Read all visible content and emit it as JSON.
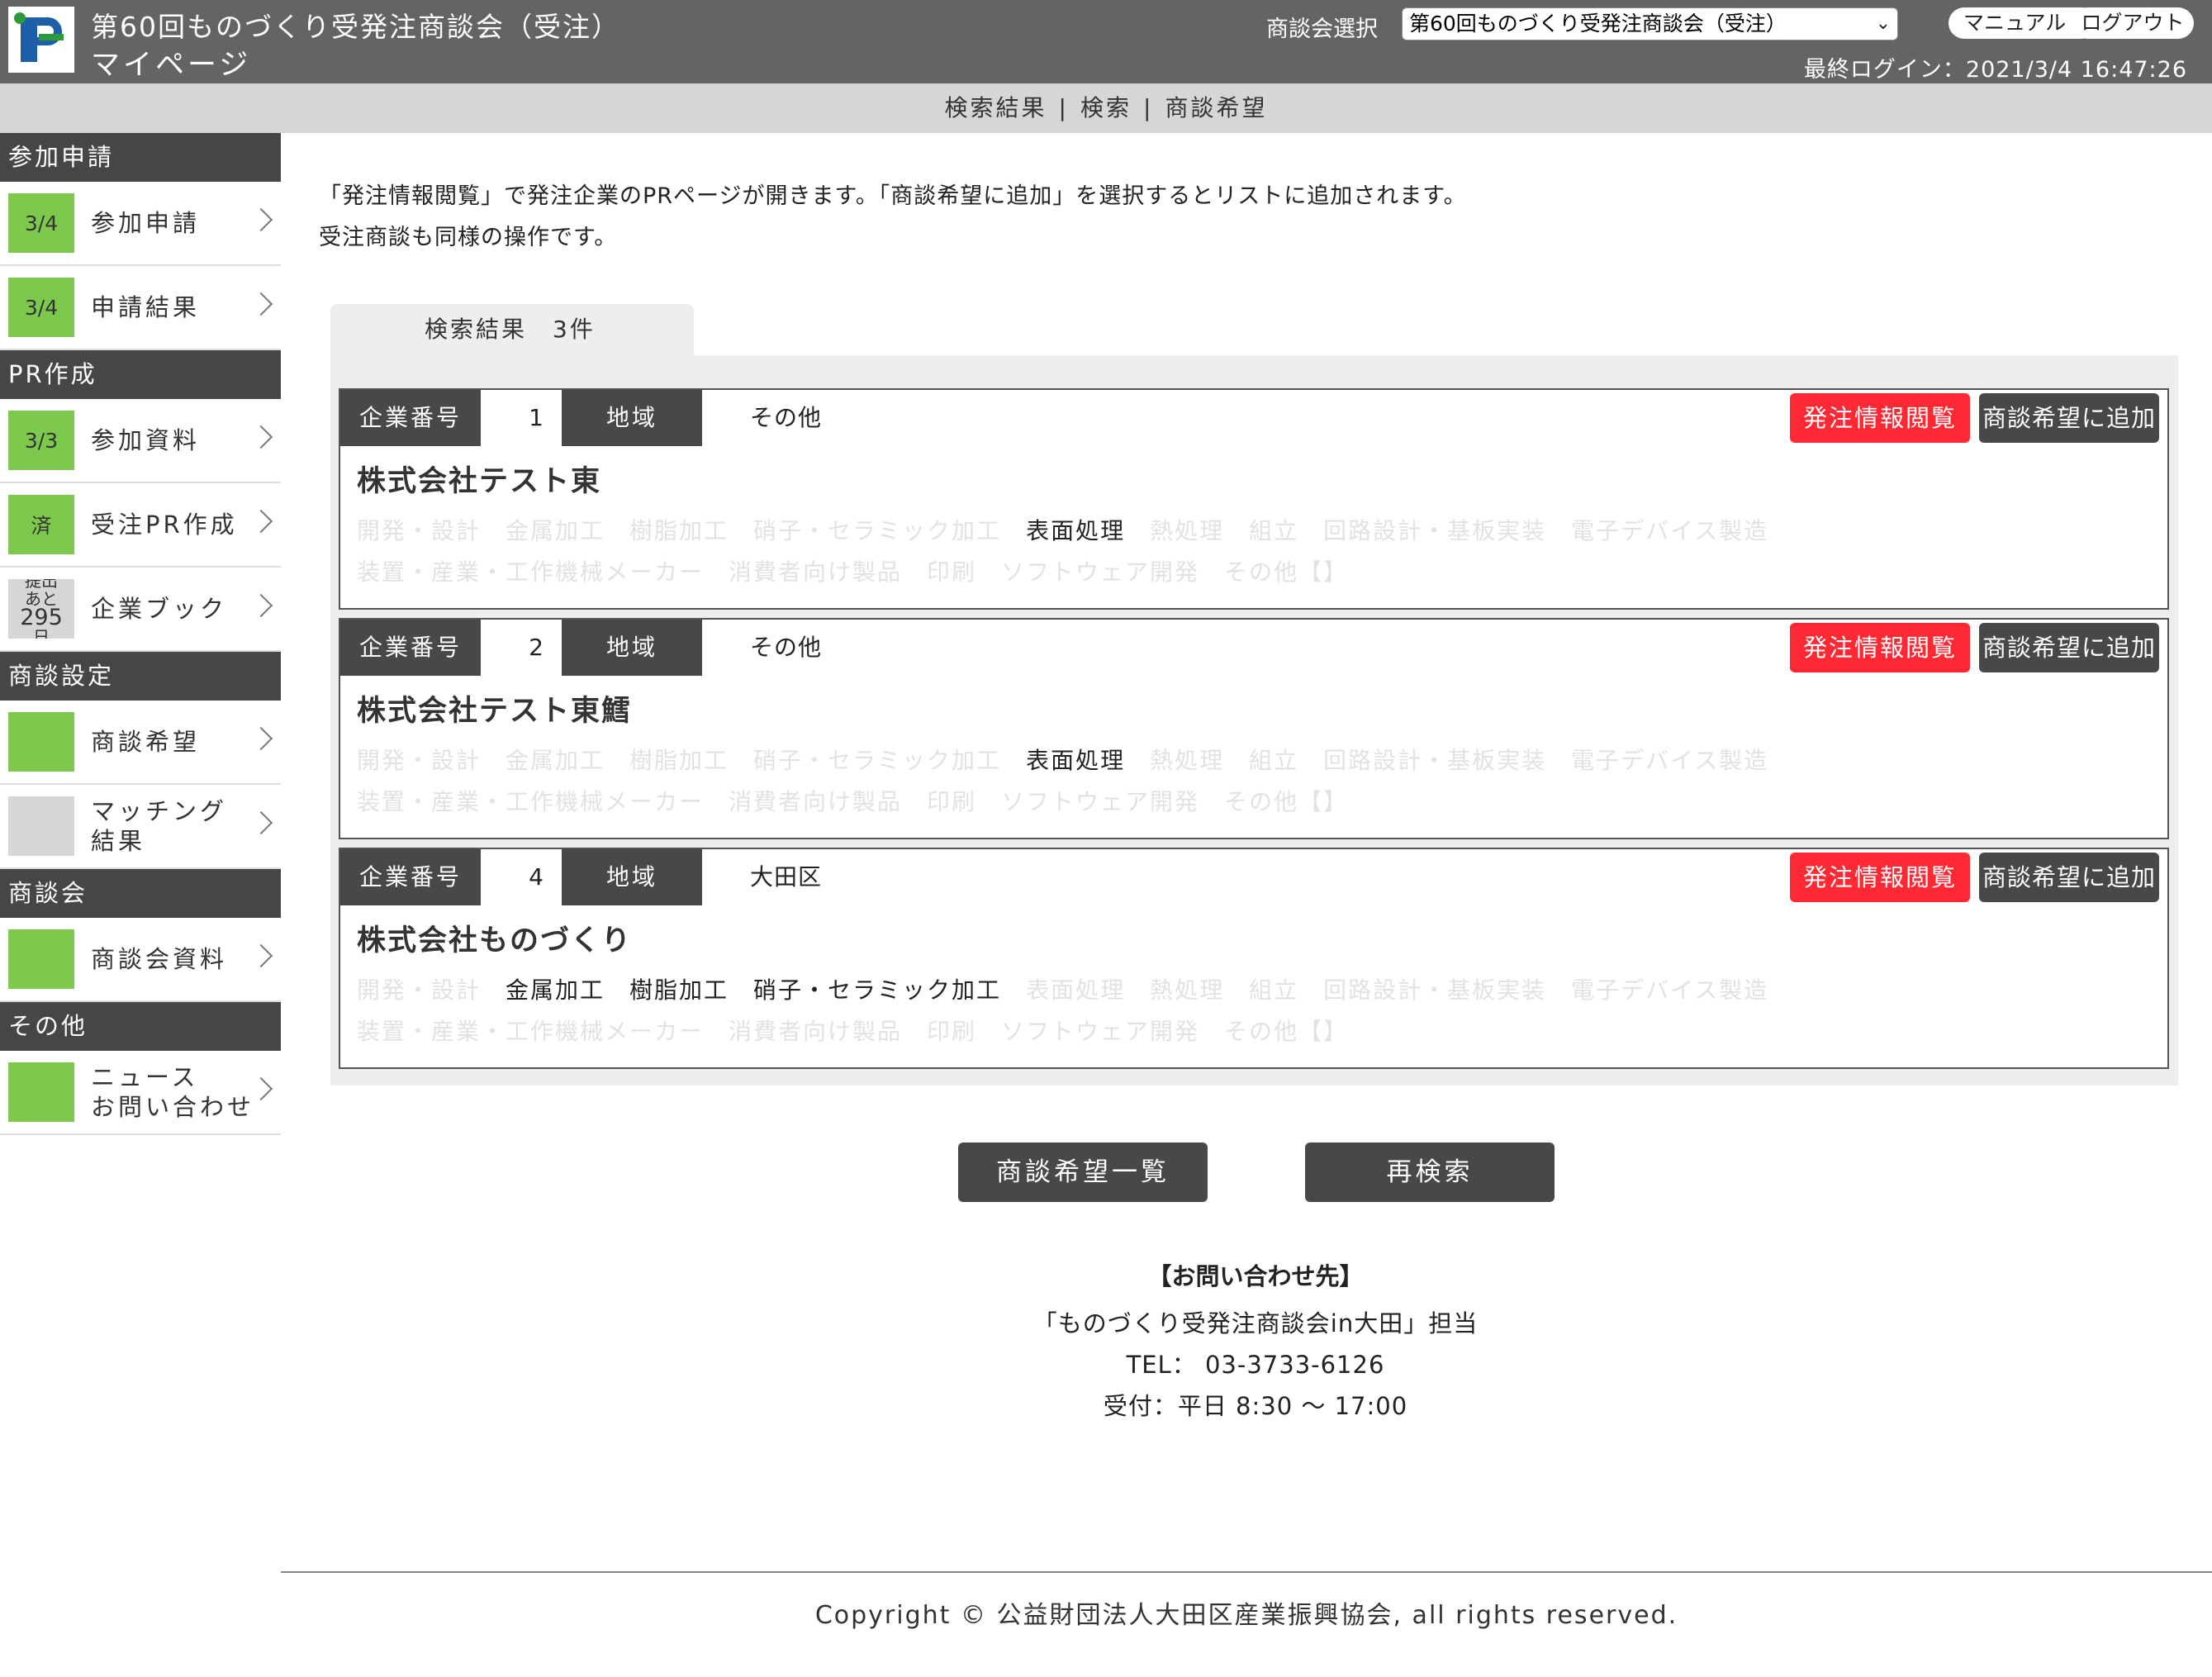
{
  "header": {
    "title": "第60回ものづくり受発注商談会（受注）",
    "subtitle": "マイページ",
    "select_label": "商談会選択",
    "select_value": "第60回ものづくり受発注商談会（受注）",
    "manual_label": "マニュアル",
    "logout_label": "ログアウト",
    "last_login": "最終ログイン：2021/3/4 16:47:26"
  },
  "subnav": {
    "items": [
      "検索結果",
      "検索",
      "商談希望"
    ],
    "sep": "|"
  },
  "sidebar": {
    "sections": [
      {
        "title": "参加申請",
        "items": [
          {
            "badge": "3/4",
            "label": "参加申請"
          },
          {
            "badge": "3/4",
            "label": "申請結果"
          }
        ]
      },
      {
        "title": "PR作成",
        "items": [
          {
            "badge": "3/3",
            "label": "参加資料"
          },
          {
            "badge": "済",
            "label": "受注PR作成"
          },
          {
            "badge_lines": [
              "提出",
              "あと",
              "295",
              "日"
            ],
            "label": "企業ブック"
          }
        ]
      },
      {
        "title": "商談設定",
        "items": [
          {
            "badge": "",
            "label": "商談希望"
          },
          {
            "badge": "",
            "label_lines": [
              "マッチング",
              "結果"
            ]
          }
        ]
      },
      {
        "title": "商談会",
        "items": [
          {
            "badge": "",
            "label": "商談会資料"
          }
        ]
      },
      {
        "title": "その他",
        "items": [
          {
            "badge": "",
            "label_lines": [
              "ニュース",
              "お問い合わせ"
            ]
          }
        ]
      }
    ]
  },
  "intro": {
    "line1": "「発注情報閲覧」で発注企業のPRページが開きます。「商談希望に追加」を選択するとリストに追加されます。",
    "line2": "受注商談も同様の操作です。"
  },
  "results": {
    "tab_label": "検索結果　3件",
    "company_no_label": "企業番号",
    "region_label": "地域",
    "view_button": "発注情報閲覧",
    "add_button": "商談希望に追加",
    "categories": [
      "開発・設計",
      "金属加工",
      "樹脂加工",
      "硝子・セラミック加工",
      "表面処理",
      "熱処理",
      "組立",
      "回路設計・基板実装",
      "電子デバイス製造",
      "装置・産業・工作機械メーカー",
      "消費者向け製品",
      "印刷",
      "ソフトウェア開発",
      "その他【】"
    ],
    "cards": [
      {
        "number": "1",
        "region": "その他",
        "name": "株式会社テスト東",
        "active": [
          "表面処理"
        ]
      },
      {
        "number": "2",
        "region": "その他",
        "name": "株式会社テスト東鱈",
        "active": [
          "表面処理"
        ]
      },
      {
        "number": "4",
        "region": "大田区",
        "name": "株式会社ものづくり",
        "active": [
          "金属加工",
          "樹脂加工",
          "硝子・セラミック加工"
        ]
      }
    ]
  },
  "actions": {
    "list_button": "商談希望一覧",
    "research_button": "再検索"
  },
  "contact": {
    "heading": "【お問い合わせ先】",
    "line1": "「ものづくり受発注商談会in大田」担当",
    "line2": "TEL： 03-3733-6126",
    "line3": "受付：平日 8:30 〜 17:00"
  },
  "footer": {
    "copyright": "Copyright © 公益財団法人大田区産業振興協会, all rights reserved."
  }
}
